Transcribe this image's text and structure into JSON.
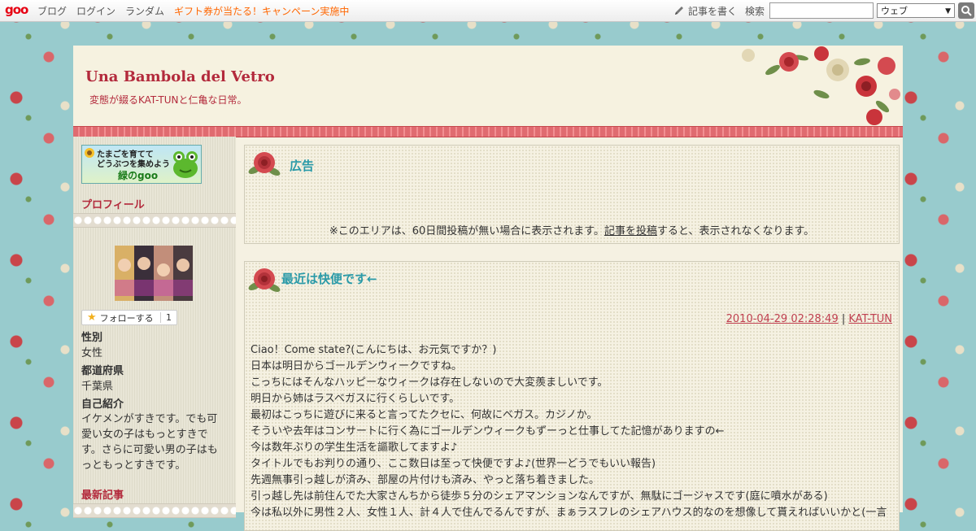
{
  "topbar": {
    "logo": "goo",
    "nav": [
      "ブログ",
      "ログイン",
      "ランダム"
    ],
    "campaign": "ギフト券が当たる！キャンペーン実施中",
    "write_label": "記事を書く",
    "search_label": "検索",
    "search_value": "",
    "search_scope": "ウェブ"
  },
  "header": {
    "title": "Una Bambola del Vetro",
    "description": "変態が綴るKAT-TUNと仁亀な日常。"
  },
  "sidebar": {
    "banner_line1": "たまごを育てて",
    "banner_line2": "どうぶつを集めよう",
    "banner_line3": "緑のgoo",
    "profile_heading": "プロフィール",
    "follow_label": "フォローする",
    "follow_count": "1",
    "gender_label": "性別",
    "gender_value": "女性",
    "prefecture_label": "都道府県",
    "prefecture_value": "千葉県",
    "intro_label": "自己紹介",
    "intro_value": "イケメンがすきです。でも可愛い女の子はもっとすきです。さらに可愛い男の子はもっともっとすきです。",
    "recent_heading": "最新記事"
  },
  "ad": {
    "title": "広告",
    "note_before": "※このエリアは、60日間投稿が無い場合に表示されます。",
    "note_link": "記事を投稿",
    "note_after": "すると、表示されなくなります。"
  },
  "post": {
    "title": "最近は快便です←",
    "datetime": "2010-04-29 02:28:49",
    "separator": "|",
    "category": "KAT-TUN",
    "lines": [
      "Ciao！Come state?(こんにちは、お元気ですか？)",
      "日本は明日からゴールデンウィークですね。",
      "こっちにはそんなハッピーなウィークは存在しないので大変羨ましいです。",
      "明日から姉はラスベガスに行くらしいです。",
      "最初はこっちに遊びに来ると言ってたクセに、何故にベガス。カジノか。",
      "そういや去年はコンサートに行く為にゴールデンウィークもずーっと仕事してた記憶がありますの←",
      "今は数年ぶりの学生生活を謳歌してますよ♪",
      "タイトルでもお判りの通り、ここ数日は至って快便ですよ♪(世界一どうでもいい報告)",
      "先週無事引っ越しが済み、部屋の片付けも済み、やっと落ち着きました。",
      "引っ越し先は前住んでた大家さんちから徒歩５分のシェアマンションなんですが、無駄にゴージャスです(庭に噴水がある)",
      "今は私以外に男性２人、女性１人、計４人で住んでるんですが、まぁラスフレのシェアハウス的なのを想像して貰えればいいかと(一言"
    ]
  },
  "colors": {
    "accent_red": "#b32a3c",
    "heading_teal": "#2a9aa8",
    "background_teal": "#98cbcd",
    "campaign_orange": "#ff6600"
  }
}
